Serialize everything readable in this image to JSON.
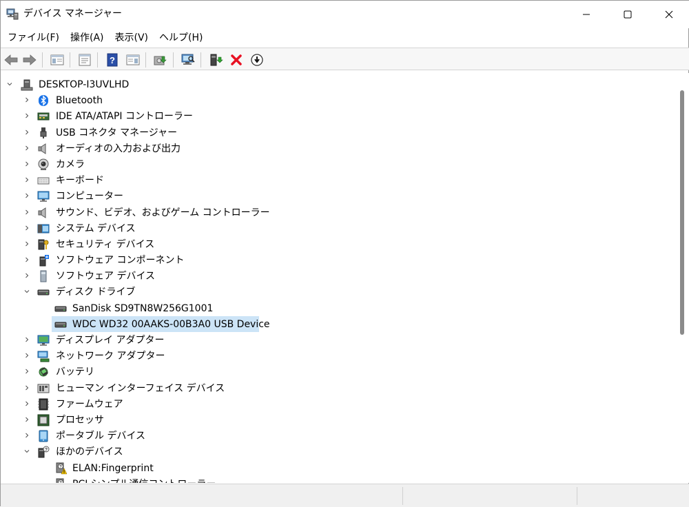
{
  "window": {
    "title": "デバイス マネージャー",
    "icon": "device-manager-icon"
  },
  "menu": [
    "ファイル(F)",
    "操作(A)",
    "表示(V)",
    "ヘルプ(H)"
  ],
  "toolbar": {
    "buttons": [
      "back-icon",
      "forward-icon",
      "show-hide-console-tree-icon",
      "properties-icon",
      "help-icon",
      "action-pane-icon",
      "update-driver-icon",
      "scan-hardware-icon",
      "enable-device-icon",
      "uninstall-device-icon",
      "disable-device-icon"
    ]
  },
  "tree": {
    "root": {
      "label": "DESKTOP-I3UVLHD",
      "expanded": true
    },
    "categories": [
      {
        "label": "Bluetooth",
        "icon": "bluetooth-icon",
        "expanded": false
      },
      {
        "label": "IDE ATA/ATAPI コントローラー",
        "icon": "ide-controller-icon",
        "expanded": false
      },
      {
        "label": "USB コネクタ マネージャー",
        "icon": "usb-connector-icon",
        "expanded": false
      },
      {
        "label": "オーディオの入力および出力",
        "icon": "speaker-icon",
        "expanded": false
      },
      {
        "label": "カメラ",
        "icon": "camera-icon",
        "expanded": false
      },
      {
        "label": "キーボード",
        "icon": "keyboard-icon",
        "expanded": false
      },
      {
        "label": "コンピューター",
        "icon": "computer-icon",
        "expanded": false
      },
      {
        "label": "サウンド、ビデオ、およびゲーム コントローラー",
        "icon": "speaker-icon",
        "expanded": false
      },
      {
        "label": "システム デバイス",
        "icon": "system-device-icon",
        "expanded": false
      },
      {
        "label": "セキュリティ デバイス",
        "icon": "security-device-icon",
        "expanded": false
      },
      {
        "label": "ソフトウェア コンポーネント",
        "icon": "software-component-icon",
        "expanded": false
      },
      {
        "label": "ソフトウェア デバイス",
        "icon": "software-device-icon",
        "expanded": false
      },
      {
        "label": "ディスク ドライブ",
        "icon": "disk-drive-icon",
        "expanded": true,
        "children": [
          {
            "label": "SanDisk SD9TN8W256G1001",
            "icon": "disk-drive-icon",
            "selected": false
          },
          {
            "label": "WDC WD32 00AAKS-00B3A0 USB Device",
            "icon": "disk-drive-icon",
            "selected": true
          }
        ]
      },
      {
        "label": "ディスプレイ アダプター",
        "icon": "display-adapter-icon",
        "expanded": false
      },
      {
        "label": "ネットワーク アダプター",
        "icon": "network-adapter-icon",
        "expanded": false
      },
      {
        "label": "バッテリ",
        "icon": "battery-icon",
        "expanded": false
      },
      {
        "label": "ヒューマン インターフェイス デバイス",
        "icon": "hid-icon",
        "expanded": false
      },
      {
        "label": "ファームウェア",
        "icon": "firmware-icon",
        "expanded": false
      },
      {
        "label": "プロセッサ",
        "icon": "processor-icon",
        "expanded": false
      },
      {
        "label": "ポータブル デバイス",
        "icon": "portable-device-icon",
        "expanded": false
      },
      {
        "label": "ほかのデバイス",
        "icon": "other-devices-icon",
        "expanded": true,
        "children": [
          {
            "label": "ELAN:Fingerprint",
            "icon": "unknown-device-warning-icon",
            "selected": false
          },
          {
            "label": "PCI シンプル通信コントローラー",
            "icon": "unknown-device-warning-icon",
            "selected": false
          }
        ]
      }
    ]
  },
  "colors": {
    "selection": "#cce4f7",
    "toolbar_bg": "#f7f7f7",
    "statusbar_bg": "#f0f0f0",
    "error_red": "#e81123"
  }
}
